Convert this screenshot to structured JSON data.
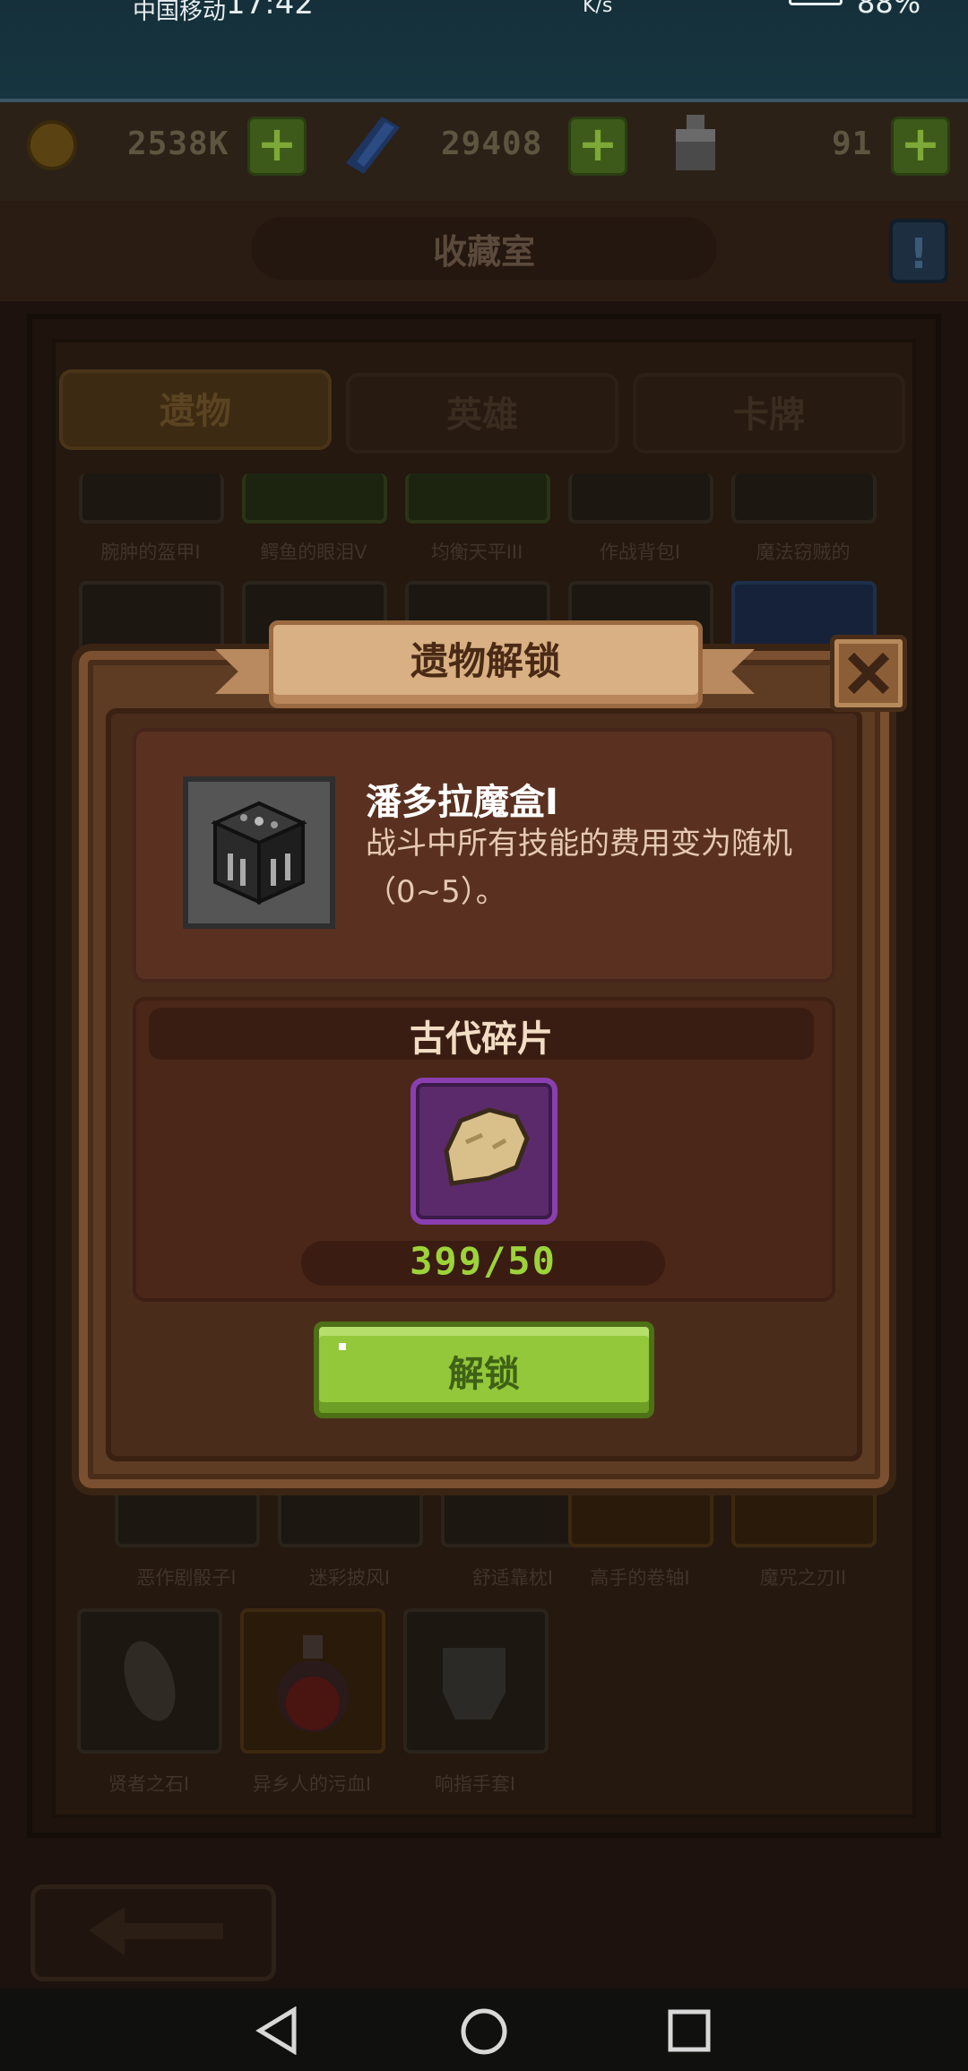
{
  "status_bar": {
    "carrier": "中国移动",
    "time": "17:42",
    "speed": "K/s",
    "battery": "88%"
  },
  "resources": {
    "gold": "2538K",
    "gems": "29408",
    "bottle": "91"
  },
  "header": {
    "title": "收藏室"
  },
  "tabs": [
    {
      "label": "遗物",
      "active": true
    },
    {
      "label": "英雄",
      "active": false
    },
    {
      "label": "卡牌",
      "active": false
    }
  ],
  "grid_rows": {
    "row1": [
      "腕肿的盔甲I",
      "鳄鱼的眼泪V",
      "均衡天平III",
      "作战背包I",
      "魔法窃贼的"
    ],
    "row2": [
      "恶作剧骰子I",
      "迷彩披风I",
      "舒适靠枕I",
      "高手的卷轴I",
      "魔咒之刃II"
    ],
    "row3": [
      "贤者之石I",
      "异乡人的污血I",
      "响指手套I"
    ]
  },
  "modal": {
    "title": "遗物解锁",
    "relic_name": "潘多拉魔盒I",
    "relic_desc": "战斗中所有技能的费用变为随机（0~5）。",
    "cost_title": "古代碎片",
    "count": "399/50",
    "unlock_label": "解锁"
  },
  "colors": {
    "accent_green": "#93c83a",
    "count_green": "#9dd33a",
    "modal_brown": "#5e3b23",
    "fragment_purple": "#8a3fb0"
  }
}
